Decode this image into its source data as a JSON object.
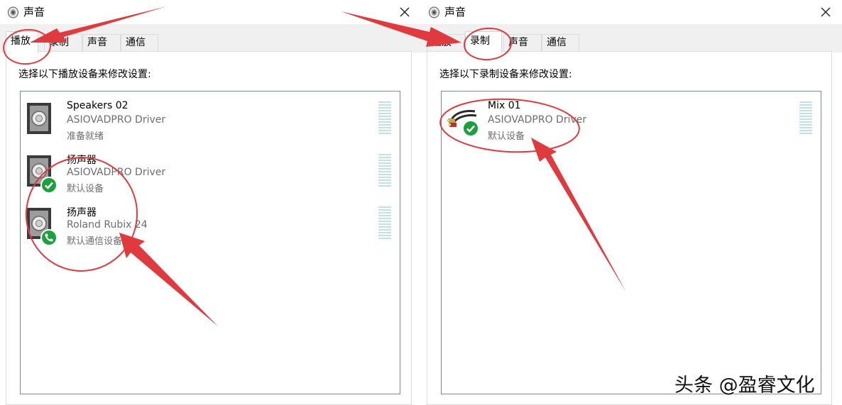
{
  "left_dialog": {
    "title": "声音",
    "tabs": [
      {
        "label": "播放",
        "active": true
      },
      {
        "label": "录制",
        "active": false
      },
      {
        "label": "声音",
        "active": false
      },
      {
        "label": "通信",
        "active": false
      }
    ],
    "instruction": "选择以下播放设备来修改设置:",
    "devices": [
      {
        "name": "Speakers 02",
        "driver": "ASIOVADPRO Driver",
        "status": "准备就绪",
        "badge": "none"
      },
      {
        "name": "扬声器",
        "driver": "ASIOVADPRO Driver",
        "status": "默认设备",
        "badge": "check-icon"
      },
      {
        "name": "扬声器",
        "driver": "Roland Rubix 24",
        "status": "默认通信设备",
        "badge": "phone-icon"
      }
    ]
  },
  "right_dialog": {
    "title": "声音",
    "tabs": [
      {
        "label": "播放",
        "active": false
      },
      {
        "label": "录制",
        "active": true
      },
      {
        "label": "声音",
        "active": false
      },
      {
        "label": "通信",
        "active": false
      }
    ],
    "instruction": "选择以下录制设备来修改设置:",
    "devices": [
      {
        "name": "Mix 01",
        "driver": "ASIOVADPRO Driver",
        "status": "默认设备",
        "badge": "check-icon"
      }
    ]
  },
  "watermark": {
    "prefix": "头条",
    "handle": "@盈睿文化"
  },
  "colors": {
    "annotation": "#e0393e",
    "badge": "#1aa13d",
    "level_meter": "#bfe1ea"
  }
}
